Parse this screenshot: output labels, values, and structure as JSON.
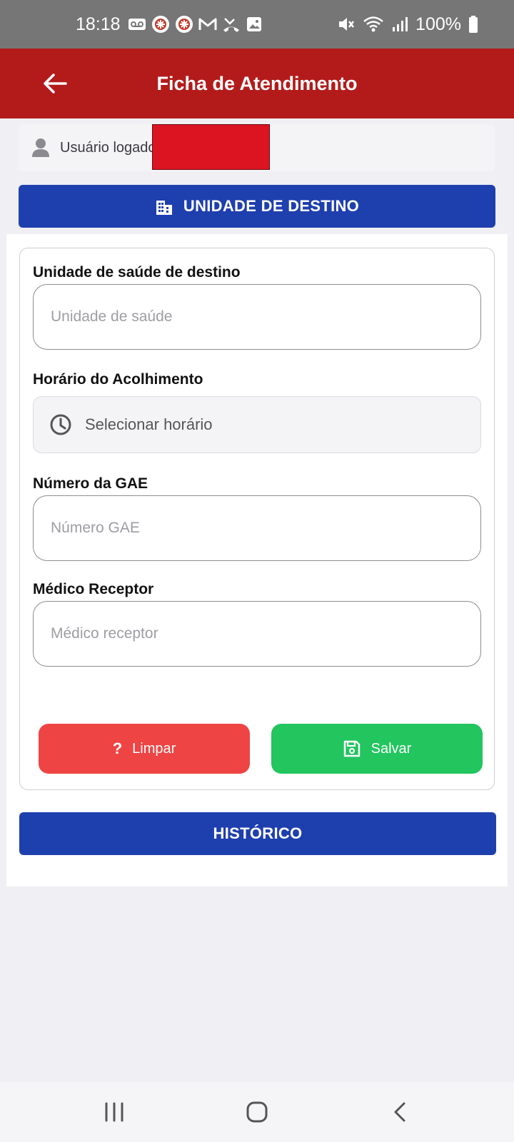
{
  "status_bar": {
    "time": "18:18",
    "battery": "100%",
    "notification_icons": [
      "voicemail-icon",
      "app-badge-icon",
      "app-badge-icon",
      "gmail-icon",
      "missed-call-icon",
      "image-icon"
    ],
    "system_icons": [
      "mute-icon",
      "wifi-icon",
      "signal-icon",
      "battery-icon"
    ]
  },
  "app_bar": {
    "title": "Ficha de Atendimento"
  },
  "user": {
    "label": "Usuário logado"
  },
  "section": {
    "title": "UNIDADE DE DESTINO"
  },
  "form": {
    "unit": {
      "label": "Unidade de saúde de destino",
      "placeholder": "Unidade de saúde",
      "value": ""
    },
    "time": {
      "label": "Horário do Acolhimento",
      "placeholder": "Selecionar horário"
    },
    "gae": {
      "label": "Número da GAE",
      "placeholder": "Número GAE",
      "value": ""
    },
    "doctor": {
      "label": "Médico Receptor",
      "placeholder": "Médico receptor",
      "value": ""
    }
  },
  "actions": {
    "clear_label": "Limpar",
    "save_label": "Salvar",
    "history_label": "HISTÓRICO"
  },
  "colors": {
    "app_bar": "#b31b1b",
    "primary_blue": "#1e3fae",
    "clear_red": "#ef4444",
    "save_green": "#22c55e"
  }
}
